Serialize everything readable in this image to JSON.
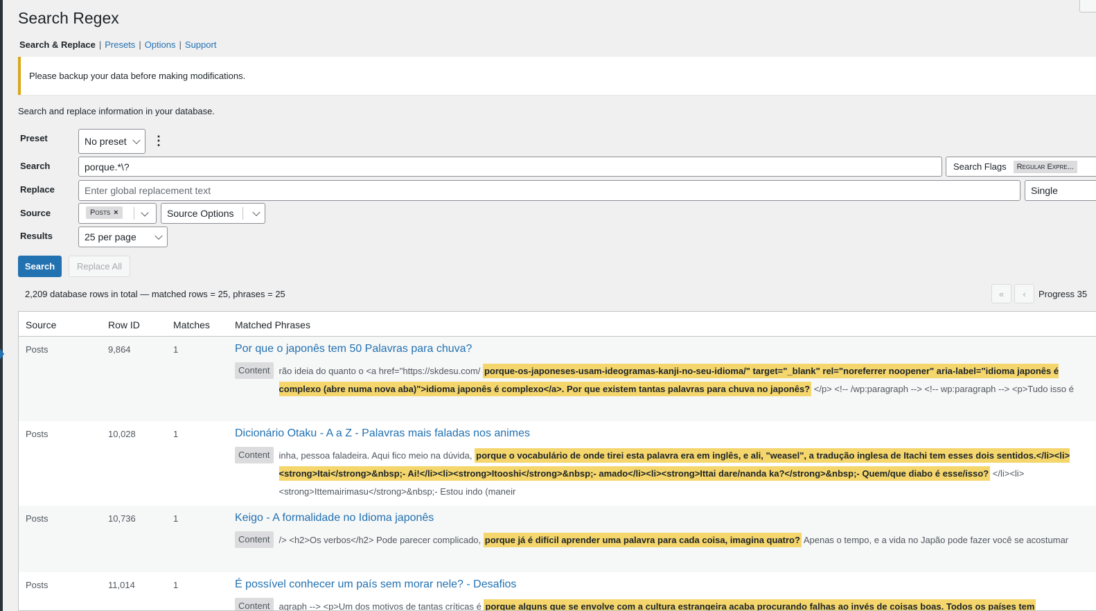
{
  "page": {
    "title": "Search Regex",
    "nav": [
      {
        "label": "Search & Replace",
        "current": true
      },
      {
        "label": "Presets",
        "current": false
      },
      {
        "label": "Options",
        "current": false
      },
      {
        "label": "Support",
        "current": false
      }
    ],
    "notice": "Please backup your data before making modifications.",
    "intro": "Search and replace information in your database."
  },
  "form": {
    "preset": {
      "label": "Preset",
      "value": "No preset"
    },
    "search": {
      "label": "Search",
      "value": "porque.*\\?",
      "flags_label": "Search Flags",
      "flag_chip": "Regular Expre..."
    },
    "replace": {
      "label": "Replace",
      "placeholder": "Enter global replacement text",
      "mode": "Single"
    },
    "source": {
      "label": "Source",
      "tag": "Posts",
      "tag_remove": "×",
      "options_label": "Source Options"
    },
    "results": {
      "label": "Results",
      "value": "25 per page"
    }
  },
  "actions": {
    "search": "Search",
    "replace_all": "Replace All"
  },
  "summary": {
    "text": "2,209 database rows in total — matched rows = 25, phrases = 25",
    "first": "«",
    "prev": "‹",
    "progress": "Progress 35"
  },
  "table": {
    "columns": [
      "Source",
      "Row ID",
      "Matches",
      "Matched Phrases"
    ],
    "context_label": "Content",
    "rows": [
      {
        "source": "Posts",
        "row_id": "9,864",
        "matches": "1",
        "title": "Por que o japonês tem 50 Palavras para chuva?",
        "before": "rão ideia do quanto o <a href=\"https://skdesu.com/",
        "match": "porque-os-japoneses-usam-ideogramas-kanji-no-seu-idioma/\" target=\"_blank\" rel=\"noreferrer noopener\" aria-label=\"idioma japonês é complexo (abre numa nova aba)\">idioma japonês é complexo</a>. Por que existem tantas palavras para chuva no japonês?",
        "after": "</p> <!-- /wp:paragraph --> <!-- wp:paragraph --> <p>Tudo isso é"
      },
      {
        "source": "Posts",
        "row_id": "10,028",
        "matches": "1",
        "title": "Dicionário Otaku - A a Z - Palavras mais faladas nos animes",
        "before": "inha, pessoa faladeira. Aqui fico meio na dúvida,",
        "match": "porque o vocabulário de onde tirei esta palavra era em inglês, e ali, \"weasel\", a tradução inglesa de Itachi tem esses dois sentidos.</li><li><strong>Itai</strong>&nbsp;- Ai!</li><li><strong>Itooshi</strong>&nbsp;- amado</li><li><strong>Ittai dare/nanda ka?</strong>&nbsp;- Quem/que diabo é esse/isso?",
        "after": "</li><li><strong>Ittemairimasu</strong>&nbsp;- Estou indo (maneir"
      },
      {
        "source": "Posts",
        "row_id": "10,736",
        "matches": "1",
        "title": "Keigo - A formalidade no Idioma japonês",
        "before": "/> <h2>Os verbos</h2> Pode parecer complicado,",
        "match": "porque já é difícil aprender uma palavra para cada coisa, imagina quatro?",
        "after": "Apenas o tempo, e a vida no Japão pode fazer você se acostumar"
      },
      {
        "source": "Posts",
        "row_id": "11,014",
        "matches": "1",
        "title": "É possível conhecer um país sem morar nele? - Desafios",
        "before": "agraph --> <p>Um dos motivos de tantas críticas é",
        "match": "porque alguns que se envolve com a cultura estrangeira acaba procurando falhas ao invés de coisas boas. Todos os países tem",
        "after": ""
      }
    ]
  }
}
